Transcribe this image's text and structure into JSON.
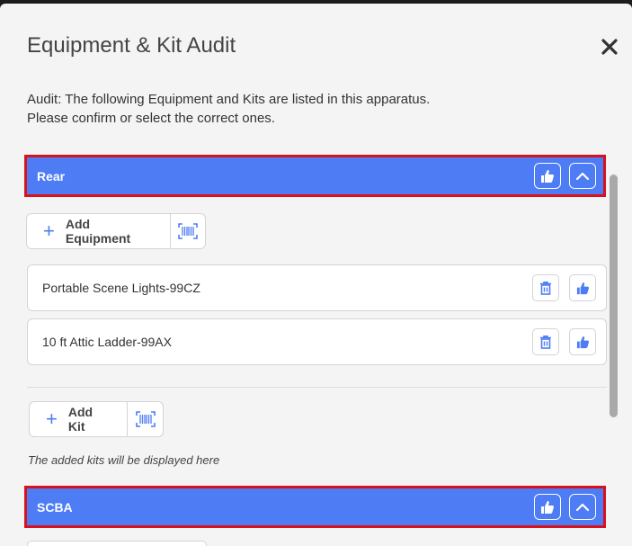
{
  "modal": {
    "title": "Equipment & Kit Audit",
    "description_line1": "Audit: The following Equipment and Kits are listed in this apparatus.",
    "description_line2": "Please confirm or select the correct ones."
  },
  "sections": [
    {
      "title": "Rear",
      "add_equipment_label": "Add Equipment",
      "items": [
        {
          "label": "Portable Scene Lights-99CZ"
        },
        {
          "label": "10 ft Attic Ladder-99AX"
        }
      ],
      "add_kit_label": "Add Kit",
      "kits_note": "The added kits will be displayed here"
    },
    {
      "title": "SCBA"
    }
  ],
  "icons": {
    "close": "close-icon",
    "thumbs_up": "thumbs-up-icon",
    "chevron_up": "chevron-up-icon",
    "plus": "plus-icon",
    "barcode": "barcode-scan-icon",
    "trash": "trash-icon"
  },
  "colors": {
    "accent": "#4d7cf4",
    "highlight_border": "#d8121b",
    "background": "#f4f4f4"
  }
}
